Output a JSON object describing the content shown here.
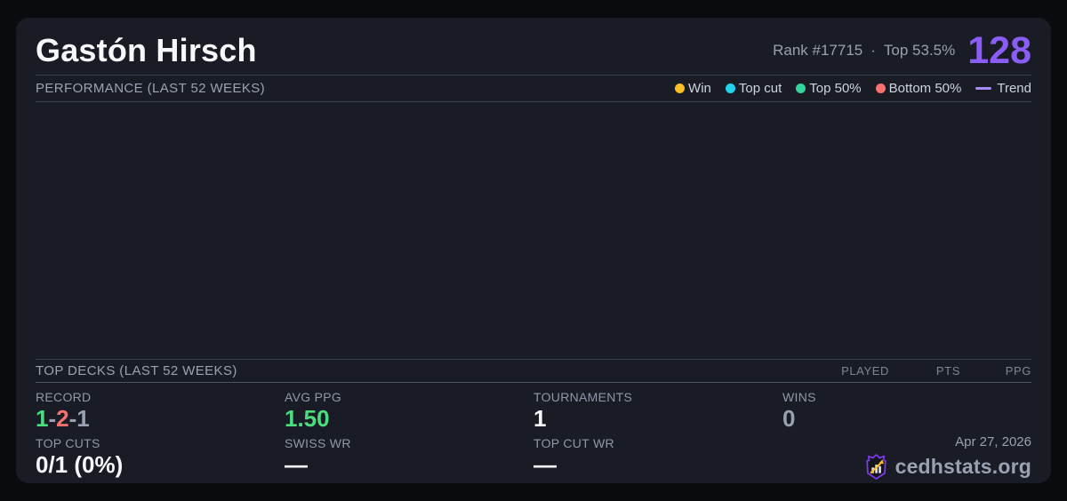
{
  "header": {
    "player_name": "Gastón Hirsch",
    "rank_text": "Rank #17715",
    "rank_separator": "·",
    "top_percent": "Top 53.5%",
    "score": "128"
  },
  "performance": {
    "section_title": "PERFORMANCE (LAST 52 WEEKS)",
    "legend": [
      {
        "label": "Win",
        "color": "#fbbf24",
        "swatch": "dot"
      },
      {
        "label": "Top cut",
        "color": "#22d3ee",
        "swatch": "dot"
      },
      {
        "label": "Top 50%",
        "color": "#34d399",
        "swatch": "dot"
      },
      {
        "label": "Bottom 50%",
        "color": "#f87171",
        "swatch": "dot"
      },
      {
        "label": "Trend",
        "color": "#a78bfa",
        "swatch": "line"
      }
    ],
    "chart": {
      "points": [],
      "note_visible_points": 0
    }
  },
  "top_decks": {
    "section_title": "TOP DECKS (LAST 52 WEEKS)",
    "columns": [
      "PLAYED",
      "PTS",
      "PPG"
    ],
    "rows": []
  },
  "stats": {
    "record": {
      "label": "RECORD",
      "wins": "1",
      "sep1": "-",
      "losses": "2",
      "sep2": "-",
      "draws": "1"
    },
    "avg_ppg": {
      "label": "AVG PPG",
      "value": "1.50"
    },
    "tournaments": {
      "label": "TOURNAMENTS",
      "value": "1"
    },
    "wins": {
      "label": "WINS",
      "value": "0"
    },
    "top_cuts": {
      "label": "TOP CUTS",
      "value": "0/1 (0%)"
    },
    "swiss_wr": {
      "label": "SWISS WR",
      "value": "—"
    },
    "top_cut_wr": {
      "label": "TOP CUT WR",
      "value": "—"
    }
  },
  "footer": {
    "date": "Apr 27, 2026",
    "brand": "cedhstats.org"
  },
  "colors": {
    "page_background": "#0a0b0f",
    "card_background": "#191c25",
    "accent_purple": "#8b5cf6",
    "trend_purple": "#a78bfa",
    "win_yellow": "#fbbf24",
    "top_cut_cyan": "#22d3ee",
    "top50_green": "#34d399",
    "bottom50_red": "#f87171",
    "positive_green": "#4ade80",
    "logo_shield_purple": "#7c3aed"
  }
}
